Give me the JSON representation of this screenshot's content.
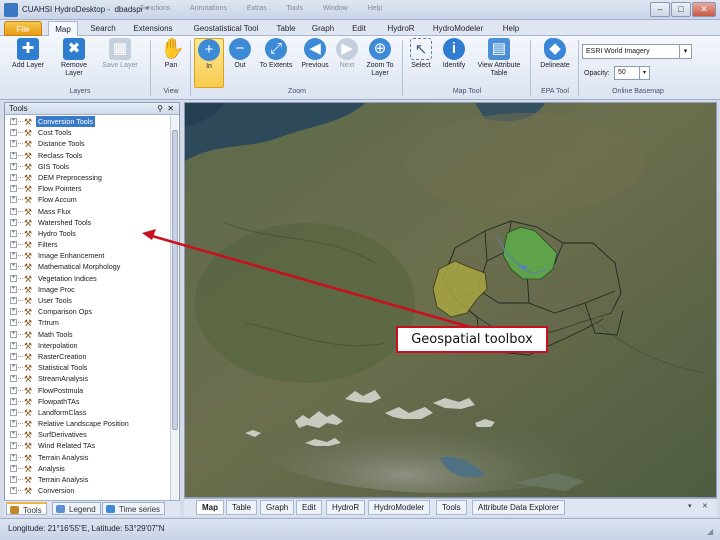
{
  "window": {
    "title": "CUAHSI HydroDesktop - ⁠ dbadspr *",
    "faded_menus": [
      "Functions",
      "Annotations",
      "Extras",
      "Tools",
      "Window",
      "Help"
    ]
  },
  "ribbon_tabs": [
    {
      "label": "File"
    },
    {
      "label": "Map"
    },
    {
      "label": "Search"
    },
    {
      "label": "Extensions"
    },
    {
      "label": "Geostatistical Tool"
    },
    {
      "label": "Table"
    },
    {
      "label": "Graph"
    },
    {
      "label": "Edit"
    },
    {
      "label": "HydroR"
    },
    {
      "label": "HydroModeler"
    },
    {
      "label": "Help"
    }
  ],
  "ribbon": {
    "buttons": [
      {
        "label": "Add Layer",
        "icon": "add-layer-icon",
        "color": "#2f7dd1"
      },
      {
        "label": "Remove Layer",
        "icon": "remove-layer-icon",
        "color": "#2f7dd1"
      },
      {
        "label": "Save Layer",
        "icon": "save-layer-icon",
        "color": "#2f7dd1"
      },
      {
        "label": "Pan",
        "icon": "hand-icon",
        "color": "#f2b640"
      },
      {
        "label": "In",
        "icon": "zoom-in-icon",
        "color": "#3d8bd7"
      },
      {
        "label": "Out",
        "icon": "zoom-out-icon",
        "color": "#3d8bd7"
      },
      {
        "label": "To Extents",
        "icon": "zoom-extents-icon",
        "color": "#3d8bd7"
      },
      {
        "label": "Previous",
        "icon": "zoom-previous-icon",
        "color": "#3d8bd7"
      },
      {
        "label": "Next",
        "icon": "zoom-next-icon",
        "color": "#3d8bd7"
      },
      {
        "label": "Zoom To Layer",
        "icon": "zoom-layer-icon",
        "color": "#3d8bd7"
      },
      {
        "label": "Select",
        "icon": "select-icon",
        "color": "#6a7a94"
      },
      {
        "label": "Identify",
        "icon": "identify-icon",
        "color": "#2f7dd1"
      },
      {
        "label": "View Attribute Table",
        "icon": "attribute-table-icon",
        "color": "#4b90d6"
      },
      {
        "label": "Delineate",
        "icon": "delineate-icon",
        "color": "#3a87d9"
      }
    ],
    "groups": [
      "Layers",
      "View",
      "Zoom",
      "Map Tool",
      "EPA Tool",
      "Online Basemap"
    ],
    "basemap_value": "ESRI World Imagery",
    "opacity_label": "Opacity:",
    "opacity_value": "50"
  },
  "tools_panel": {
    "title": "Tools",
    "pin_glyph": "⚲",
    "close_glyph": "✕",
    "items": [
      "Conversion Tools",
      "Cost Tools",
      "Distance Tools",
      "Reclass Tools",
      "GIS Tools",
      "DEM Preprocessing",
      "Flow Pointers",
      "Flow Accum",
      "Mass Flux",
      "Watershed Tools",
      "Hydro Tools",
      "Filters",
      "Image Enhancement",
      "Mathematical Morphology",
      "Vegetation Indices",
      "Image Proc",
      "User Tools",
      "Comparison Ops",
      "Trtrum",
      "Math Tools",
      "Interpolation",
      "RasterCreation",
      "Statistical Tools",
      "StreamAnalysis",
      "FlowPostmula",
      "FlowpathTAs",
      "LandformClass",
      "Relative Landscape Position",
      "SurfDerivatives",
      "Wind Related TAs",
      "Terrain Analysis",
      "Analysis",
      "Terrain Analysis",
      "Conversion"
    ],
    "selected_index": 0,
    "bottom_tabs": [
      {
        "label": "Tools",
        "color": "#c0882a"
      },
      {
        "label": "Legend",
        "color": "#5b8fd4"
      },
      {
        "label": "Time series",
        "color": "#3d8bd7"
      }
    ]
  },
  "map_tabs": [
    "Map",
    "Table",
    "Graph",
    "Edit",
    "HydroR",
    "HydroModeler",
    "Tools",
    "Attribute Data Explorer"
  ],
  "annotation": {
    "label": "Geospatial toolbox"
  },
  "status": {
    "text": "Longitude: 21°16'55\"E, Latitude: 53°29'07\"N"
  }
}
